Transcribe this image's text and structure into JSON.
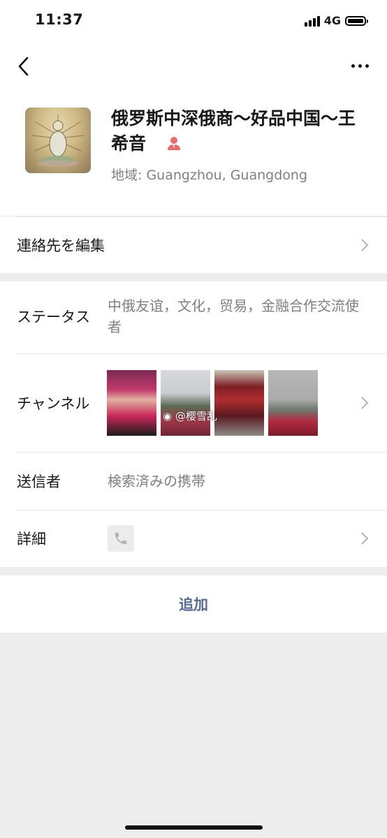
{
  "status_bar": {
    "time": "11:37",
    "network": "4G"
  },
  "profile": {
    "name": "俄罗斯中深俄商〜好品中国〜王希音",
    "region": "地域: Guangzhou, Guangdong"
  },
  "rows": {
    "edit_contact": "連絡先を編集",
    "status_label": "ステータス",
    "status_value": "中俄友谊，文化，贸易，金融合作交流使者",
    "channel_label": "チャンネル",
    "channel_watermark": "@樱雪乱",
    "sender_label": "送信者",
    "sender_value": "検索済みの携帯",
    "detail_label": "詳細"
  },
  "add_button": "追加",
  "colors": {
    "link": "#576b95",
    "secondary_text": "#7f7f7f",
    "background": "#ededed",
    "person_icon": "#e96a6a"
  },
  "icons": [
    "back-arrow-icon",
    "more-icon",
    "person-icon",
    "chevron-right-icon",
    "phone-icon",
    "weibo-icon"
  ]
}
